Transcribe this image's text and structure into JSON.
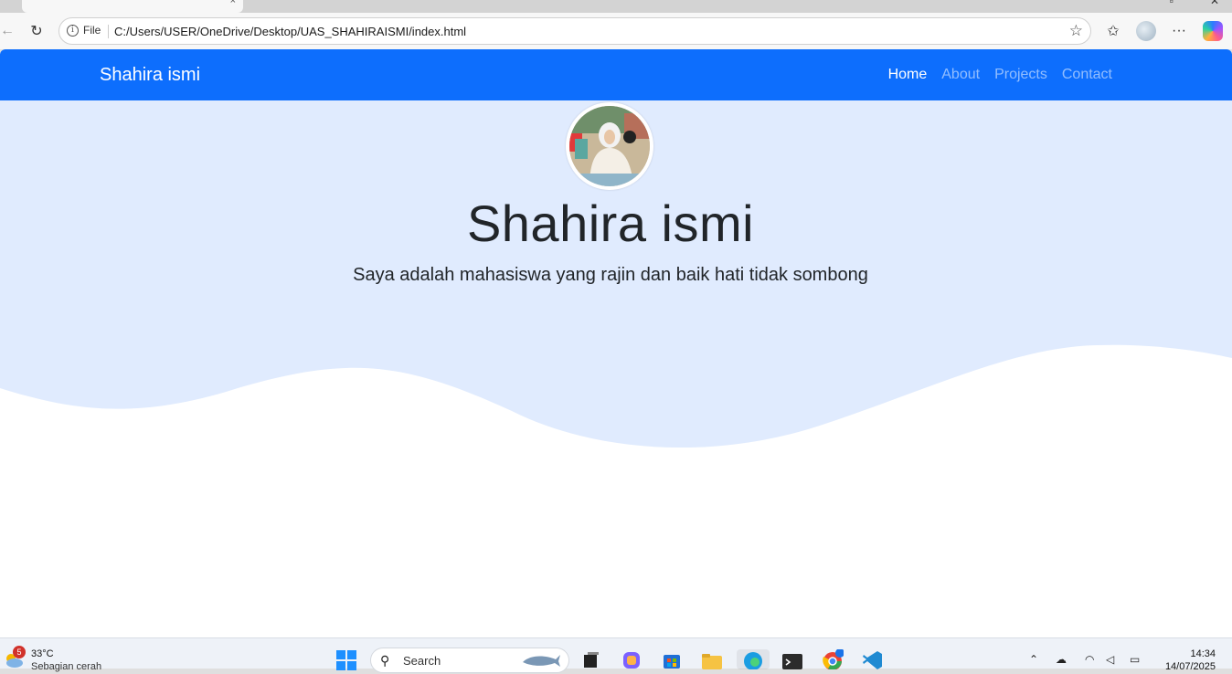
{
  "browser": {
    "tab_close": "×",
    "address": {
      "scheme_label": "File",
      "url": "C:/Users/USER/OneDrive/Desktop/UAS_SHAHIRAISMI/index.html"
    },
    "icons": {
      "back": "←",
      "refresh": "↻",
      "star": "☆",
      "favorites": "✩",
      "more": "···"
    }
  },
  "page": {
    "brand": "Shahira ismi",
    "nav": [
      {
        "label": "Home",
        "active": true
      },
      {
        "label": "About",
        "active": false
      },
      {
        "label": "Projects",
        "active": false
      },
      {
        "label": "Contact",
        "active": false
      }
    ],
    "hero": {
      "name": "Shahira ismi",
      "tagline": "Saya adalah mahasiswa yang rajin dan baik hati tidak sombong"
    },
    "colors": {
      "navbar": "#0d6efd",
      "hero_bg": "#e0ebfe"
    }
  },
  "taskbar": {
    "weather": {
      "badge": "5",
      "temp": "33°C",
      "desc": "Sebagian cerah"
    },
    "search_label": "Search",
    "clock": {
      "time": "14:34",
      "date": "14/07/2025"
    }
  }
}
